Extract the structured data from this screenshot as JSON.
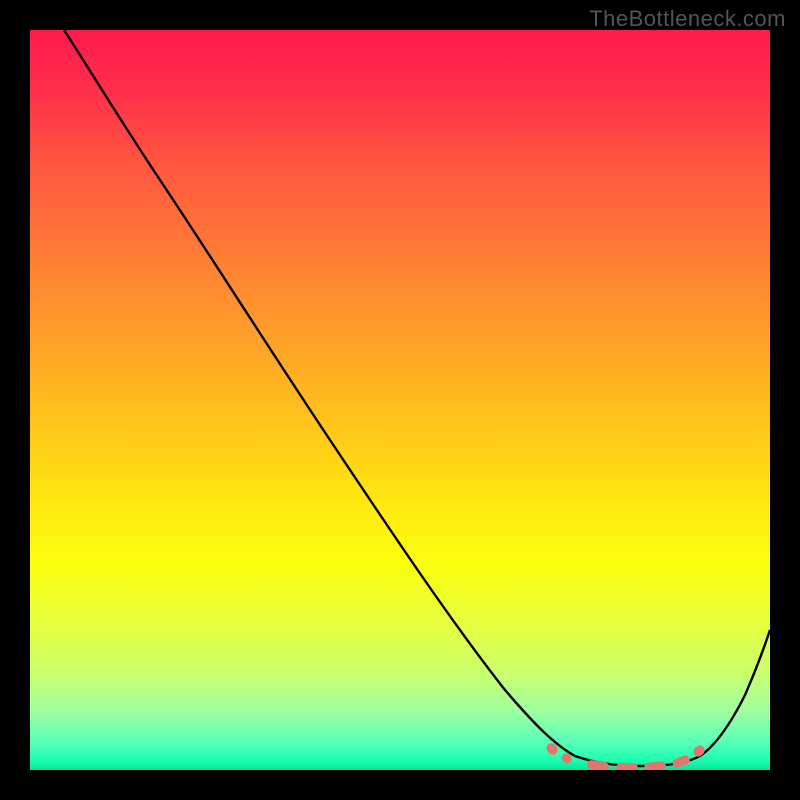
{
  "watermark": "TheBottleneck.com",
  "chart_data": {
    "type": "line",
    "title": "",
    "xlabel": "",
    "ylabel": "",
    "xlim": [
      0,
      100
    ],
    "ylim": [
      0,
      100
    ],
    "grid": false,
    "legend": false,
    "background": "heatmap-gradient",
    "gradient_description": "vertical gradient from red (top, high bottleneck) to green (bottom, low bottleneck)",
    "series": [
      {
        "name": "bottleneck-curve",
        "color": "#000000",
        "x": [
          5,
          10,
          15,
          20,
          25,
          30,
          35,
          40,
          45,
          50,
          55,
          60,
          65,
          70,
          72,
          75,
          78,
          82,
          86,
          88,
          92,
          95,
          100
        ],
        "y": [
          100,
          93,
          85,
          77,
          69,
          61,
          53,
          45,
          37,
          29,
          22,
          15,
          9,
          4,
          2,
          1,
          0.5,
          0.3,
          0.5,
          1,
          4,
          8,
          16
        ]
      }
    ],
    "markers": {
      "name": "optimum-zone",
      "shape": "rounded-dash",
      "color": "#e0766e",
      "points_x": [
        70,
        72,
        77,
        81,
        85,
        88,
        90
      ],
      "points_y": [
        3,
        1.5,
        0.5,
        0.3,
        0.5,
        1.2,
        2.5
      ]
    }
  }
}
